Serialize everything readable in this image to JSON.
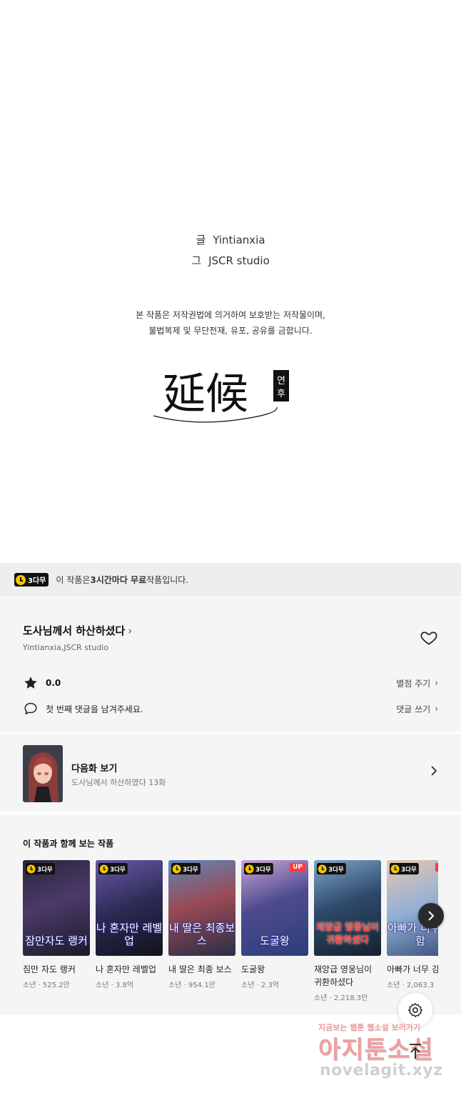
{
  "credits": {
    "writer_label": "글",
    "writer": "Yintianxia",
    "artist_label": "그",
    "artist": "JSCR studio"
  },
  "notice": {
    "line1": "본 작품은 저작권법에 의거하여 보호받는 저작물이며,",
    "line2": "불법복제 및 무단전재, 유포, 공유를 금합니다."
  },
  "logo": {
    "hanja": "延候",
    "hangul": "연후"
  },
  "free_bar": {
    "badge": "3다무",
    "text_pre": "이 작품은 ",
    "text_bold": "3시간마다 무료",
    "text_post": " 작품입니다."
  },
  "series": {
    "title": "도사님께서 하산하셨다",
    "authors": "Yintianxia,JSCR studio",
    "rating": "0.0",
    "rate_action": "별점 주기",
    "comment_prompt": "첫 번째 댓글을 남겨주세요.",
    "comment_action": "댓글 쓰기"
  },
  "next_episode": {
    "label": "다음화 보기",
    "subtitle": "도사님께서 하산하였다 13화"
  },
  "recommendations": {
    "title": "이 작품과 함께 보는 작품",
    "items": [
      {
        "name": "짐만 자도 랭커",
        "meta": "소년 · 525.2만",
        "badge": "3다무",
        "cover_text": "잠만자도 랭커",
        "up": ""
      },
      {
        "name": "나 혼자만 레벨업",
        "meta": "소년 · 3.8억",
        "badge": "3다무",
        "cover_text": "나 혼자만 레벨업",
        "up": ""
      },
      {
        "name": "내 딸은 최종 보스",
        "meta": "소년 · 954.1만",
        "badge": "3다무",
        "cover_text": "내 딸은 최종보스",
        "up": ""
      },
      {
        "name": "도굴왕",
        "meta": "소년 · 2.3억",
        "badge": "3다무",
        "cover_text": "도굴왕",
        "up": "UP"
      },
      {
        "name": "재앙급 영웅님이 귀환하셨다",
        "meta": "소년 · 2,218.3만",
        "badge": "3다무",
        "cover_text": "재앙급 영웅님이 귀환하셨다",
        "up": ""
      },
      {
        "name": "아빠가 너무 강",
        "meta": "소년 · 2,063.3",
        "badge": "3다무",
        "cover_text": "아빠가 너무 강함",
        "up": "UP"
      }
    ]
  },
  "watermark": {
    "line1": "지금보는 웹툰 웹소설 보러가기",
    "line2": "아지툰소설",
    "line3": "novelagit.xyz"
  },
  "colors": {
    "badge_bg": "#111111",
    "badge_clock": "#f5c400",
    "up_badge": "#ff3b3b",
    "panel_bg": "#f5f5f5",
    "free_bar_bg": "#eeeeee"
  }
}
